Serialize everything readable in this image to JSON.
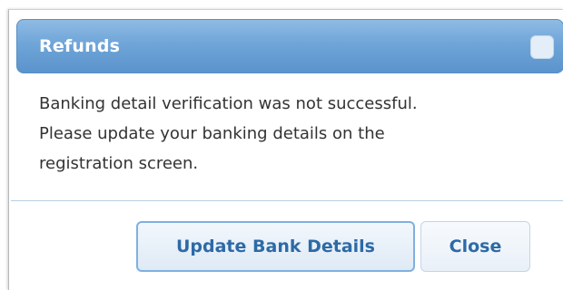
{
  "dialog": {
    "title": "Refunds",
    "title_icon": "window-control-icon",
    "message_lines": [
      "Banking detail verification was not successful.",
      "Please update your banking details on the",
      "registration screen."
    ],
    "buttons": {
      "update_label": "Update Bank Details",
      "close_label": "Close"
    }
  },
  "colors": {
    "titlebar": "#6fa5d8",
    "button_text": "#2d6aa6",
    "primary_button_border": "#7fb0e0"
  }
}
